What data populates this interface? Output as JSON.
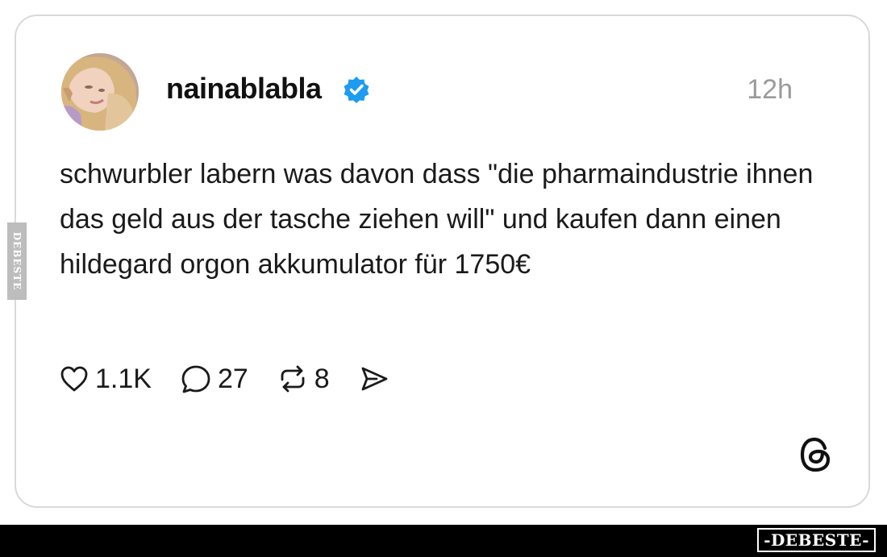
{
  "post": {
    "username": "nainablabla",
    "timestamp": "12h",
    "text": "schwurbler labern was davon dass \"die pharmaindustrie ihnen das geld aus der tasche ziehen will\" und kaufen dann einen hildegard orgon akkumulator für 1750€",
    "likes": "1.1K",
    "replies": "27",
    "reposts": "8"
  },
  "icons": {
    "verified": "verified-badge-icon",
    "like": "heart-icon",
    "reply": "comment-bubble-icon",
    "repost": "repost-icon",
    "share": "send-icon",
    "platform": "threads-logo-icon"
  },
  "colors": {
    "verified_blue": "#1d9bf0",
    "timestamp_gray": "#9a9a9a",
    "text": "#1a1a1a"
  },
  "watermark": {
    "side": "DEBESTE",
    "bottom": "-DEBESTE-"
  }
}
